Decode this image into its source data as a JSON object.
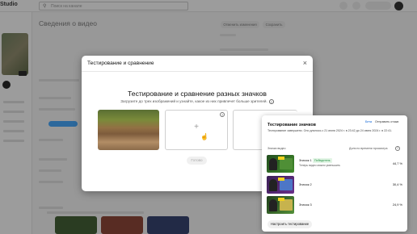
{
  "app": {
    "logo_text": "Studio"
  },
  "search": {
    "placeholder": "Поиск на канале"
  },
  "page": {
    "title": "Сведения о видео",
    "undo_label": "Отменить изменения",
    "save_label": "Сохранить"
  },
  "modal": {
    "title": "Тестирование и сравнение",
    "heading": "Тестирование и сравнение разных значков",
    "subtitle": "Загрузите до трех изображений и узнайте, какое из них привлечет больше зрителей.",
    "help_glyph": "?",
    "done_label": "Готово",
    "close_glyph": "×",
    "add_glyph": "+"
  },
  "panel": {
    "title": "Тестирование значков",
    "beta_label": "Бета",
    "feedback_label": "Отправить отзыв",
    "description": "Тестирование завершено. Оно длилось с 21 июня 2024 г. в 23:42 до 24 июня 2024 г. в 22:41.",
    "col_thumbnail": "Значки видео",
    "col_watch_share": "Доля по времени просмотра",
    "rows": [
      {
        "name": "Значок 1",
        "winner": "Победитель",
        "caption": "Теперь видео можно уменьшить",
        "percent": "44,7 %"
      },
      {
        "name": "Значок 2",
        "percent": "30,4 %"
      },
      {
        "name": "Значок 3",
        "percent": "24,9 %"
      }
    ],
    "setup_label": "Настроить тестирование"
  },
  "icons": [
    "search-icon",
    "close-icon",
    "plus-icon",
    "help-icon",
    "hand-cursor-icon"
  ],
  "colors": {
    "accent": "#065fd4",
    "winner_bg": "#e3f5e6",
    "winner_text": "#1e8e3e",
    "scrim": "rgba(20,20,20,0.42)"
  }
}
